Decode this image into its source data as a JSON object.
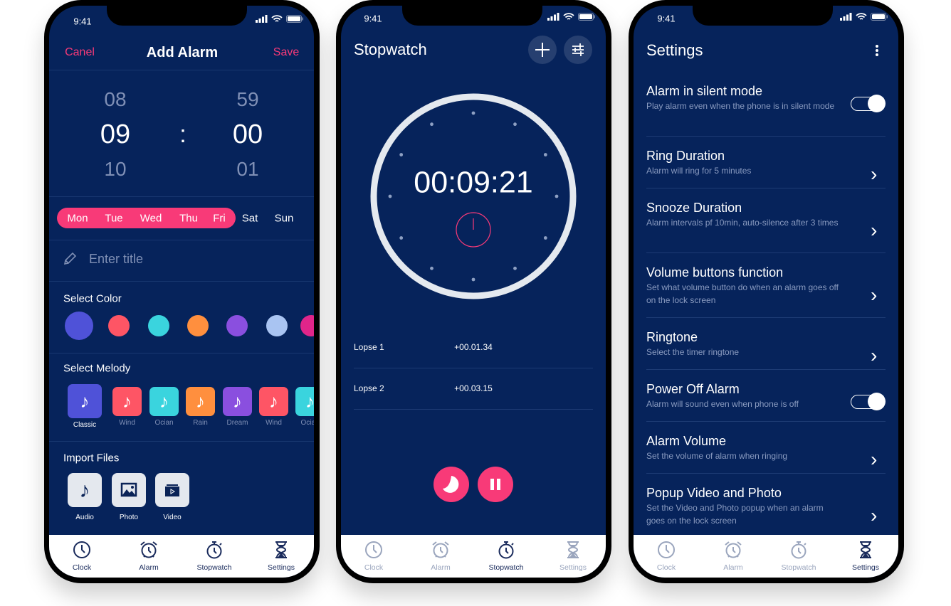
{
  "colors": {
    "background": "#06235b",
    "accent": "#f83a78",
    "nav_bg": "#ffffff"
  },
  "status": {
    "time": "9:41"
  },
  "nav": [
    {
      "label": "Clock",
      "icon": "clock-icon"
    },
    {
      "label": "Alarm",
      "icon": "alarm-icon"
    },
    {
      "label": "Stopwatch",
      "icon": "stopwatch-icon"
    },
    {
      "label": "Settings",
      "icon": "hourglass-icon"
    }
  ],
  "add_alarm": {
    "cancel": "Canel",
    "title": "Add Alarm",
    "save": "Save",
    "hours": {
      "prev": "08",
      "current": "09",
      "next": "10"
    },
    "separator": ":",
    "minutes": {
      "prev": "59",
      "current": "00",
      "next": "01"
    },
    "days": [
      {
        "label": "Mon",
        "selected": true
      },
      {
        "label": "Tue",
        "selected": true
      },
      {
        "label": "Wed",
        "selected": true
      },
      {
        "label": "Thu",
        "selected": true
      },
      {
        "label": "Fri",
        "selected": true
      },
      {
        "label": "Sat",
        "selected": false
      },
      {
        "label": "Sun",
        "selected": false
      }
    ],
    "title_placeholder": "Enter title",
    "select_color_label": "Select Color",
    "colors": [
      "#4f52d8",
      "#fe5565",
      "#3ad4de",
      "#ff8f3e",
      "#8a4fdf",
      "#a9c4f2",
      "#e0258a"
    ],
    "selected_color": 0,
    "select_melody_label": "Select Melody",
    "melodies": [
      {
        "label": "Classic",
        "color": "#4f52d8",
        "selected": true
      },
      {
        "label": "Wind",
        "color": "#fe5565"
      },
      {
        "label": "Ocian",
        "color": "#3ad4de"
      },
      {
        "label": "Rain",
        "color": "#ff8f3e"
      },
      {
        "label": "Dream",
        "color": "#8a4fdf"
      },
      {
        "label": "Wind",
        "color": "#fe5565"
      },
      {
        "label": "Ocian",
        "color": "#3ad4de"
      }
    ],
    "import_label": "Import Files",
    "imports": [
      {
        "label": "Audio",
        "icon": "music-note-icon"
      },
      {
        "label": "Photo",
        "icon": "image-icon"
      },
      {
        "label": "Video",
        "icon": "video-icon"
      }
    ],
    "active_nav": "Settings"
  },
  "stopwatch": {
    "title": "Stopwatch",
    "elapsed": "00:09:21",
    "laps": [
      {
        "name": "Lopse 1",
        "split": "+00.01.34",
        "total": "+00.01.34"
      },
      {
        "name": "Lopse 2",
        "split": "+00.03.15",
        "total": "+00.03.15"
      }
    ],
    "active_nav": "Stopwatch"
  },
  "settings": {
    "title": "Settings",
    "items": [
      {
        "title": "Alarm in silent mode",
        "subtitle": "Play alarm even when the phone is in silent mode",
        "control": "toggle",
        "on": true
      },
      {
        "title": "Ring Duration",
        "subtitle": "Alarm will ring for 5 minutes",
        "control": "chevron"
      },
      {
        "title": "Snooze Duration",
        "subtitle": "Alarm intervals pf 10min,  auto-silence after 3 times",
        "control": "chevron"
      },
      {
        "title": "Volume buttons function",
        "subtitle": "Set what volume button do when an alarm goes off on the lock screen",
        "control": "chevron"
      },
      {
        "title": "Ringtone",
        "subtitle": "Select the timer ringtone",
        "control": "chevron"
      },
      {
        "title": "Power Off Alarm",
        "subtitle": "Alarm will sound even when phone is off",
        "control": "toggle",
        "on": true
      },
      {
        "title": "Alarm Volume",
        "subtitle": "Set the volume of alarm when ringing",
        "control": "chevron"
      },
      {
        "title": "Popup Video and Photo",
        "subtitle": "Set the Video and Photo popup when an alarm goes on the lock screen",
        "control": "chevron"
      }
    ],
    "active_nav": "Settings"
  }
}
